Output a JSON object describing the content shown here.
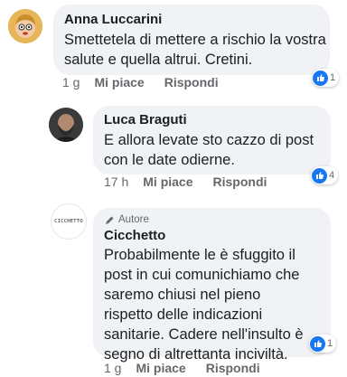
{
  "comments": [
    {
      "author": "Anna Luccarini",
      "lines": [
        "Smettetela di mettere a rischio la vostra",
        "salute e quella altrui. Cretini."
      ],
      "reactions_count": "1",
      "time": "1 g",
      "like_label": "Mi piace",
      "reply_label": "Rispondi"
    },
    {
      "author": "Luca Braguti",
      "lines": [
        "E allora levate sto cazzo di post",
        "con le date odierne."
      ],
      "reactions_count": "4",
      "time": "17 h",
      "like_label": "Mi piace",
      "reply_label": "Rispondi"
    },
    {
      "author": "Cicchetto",
      "badge": "Autore",
      "avatar_text": "CICCHETTO",
      "lines": [
        "Probabilmente le è sfuggito il",
        "post in cui comunichiamo che",
        "saremo chiusi nel pieno",
        "rispetto delle indicazioni",
        "sanitarie. Cadere nell'insulto è",
        "segno di altrettanta inciviltà."
      ],
      "reactions_count": "1",
      "time": "1 g",
      "like_label": "Mi piace",
      "reply_label": "Rispondi"
    }
  ],
  "colors": {
    "bubble": "#f0f2f5",
    "like_blue": "#1877f2",
    "meta_gray": "#65676b"
  }
}
